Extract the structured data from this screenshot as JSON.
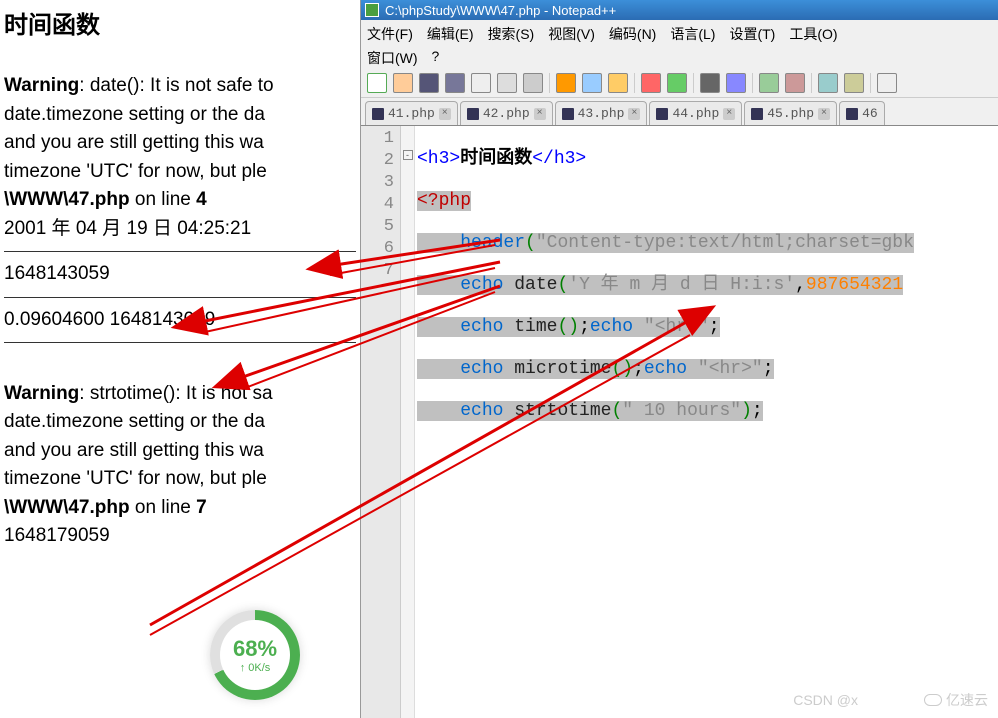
{
  "browser": {
    "heading": "时间函数",
    "warning1": {
      "label": "Warning",
      "msg1": ": date(): It is not safe to",
      "msg2": "date.timezone setting or the da",
      "msg3": "and you are still getting this wa",
      "msg4": "timezone 'UTC' for now, but ple",
      "path": "\\WWW\\47.php",
      "online": " on line ",
      "line": "4"
    },
    "date_output": "2001 年 04 月 19 日 04:25:21",
    "time_output": "1648143059",
    "microtime_output": "0.09604600 1648143059",
    "warning2": {
      "label": "Warning",
      "msg1": ": strtotime(): It is not sa",
      "msg2": "date.timezone setting or the da",
      "msg3": "and you are still getting this wa",
      "msg4": "timezone 'UTC' for now, but ple",
      "path": "\\WWW\\47.php",
      "online": " on line ",
      "line": "7"
    },
    "strtotime_output": "1648179059"
  },
  "npp": {
    "title": "C:\\phpStudy\\WWW\\47.php - Notepad++",
    "menu": {
      "row1": [
        "文件(F)",
        "编辑(E)",
        "搜索(S)",
        "视图(V)",
        "编码(N)",
        "语言(L)",
        "设置(T)",
        "工具(O)"
      ],
      "row2": [
        "窗口(W)",
        "?"
      ]
    },
    "toolbar_icons": [
      "new",
      "open",
      "save",
      "saveall",
      "close",
      "closeall",
      "print",
      "|",
      "cut",
      "copy",
      "paste",
      "|",
      "undo",
      "redo",
      "|",
      "find",
      "replace",
      "|",
      "zoom1",
      "zoom2",
      "|",
      "sync",
      "sync2",
      "|",
      "wrap"
    ],
    "tabs": [
      "41.php",
      "42.php",
      "43.php",
      "44.php",
      "45.php",
      "46"
    ],
    "code": {
      "line_numbers": [
        "1",
        "2",
        "3",
        "4",
        "5",
        "6",
        "7"
      ],
      "l1": {
        "tag_open": "<h3>",
        "text": "时间函数",
        "tag_close": "</h3>"
      },
      "l2": {
        "php_open": "<?php"
      },
      "l3": {
        "kw": "header",
        "paren1": "(",
        "str": "\"Content-type:text/html;charset=gbk",
        "paren2": ""
      },
      "l4": {
        "kw": "echo ",
        "func": "date",
        "paren1": "(",
        "str": "'Y 年 m 月 d 日 H:i:s'",
        "comma": ",",
        "num": "987654321",
        "paren2": ""
      },
      "l5": {
        "kw1": "echo ",
        "func1": "time",
        "p1": "()",
        "semi1": ";",
        "kw2": "echo ",
        "str2": "\"<hr>\"",
        "semi2": ";"
      },
      "l6": {
        "kw1": "echo ",
        "func1": "microtime",
        "p1": "()",
        "semi1": ";",
        "kw2": "echo ",
        "str2": "\"<hr>\"",
        "semi2": ";"
      },
      "l7": {
        "kw1": "echo ",
        "func1": "strtotime",
        "p1": "(",
        "str": "\" 10 hours\"",
        "p2": ")",
        "semi": ";"
      }
    }
  },
  "gauge": {
    "pct": "68%",
    "sub": "↑ 0K/s"
  },
  "watermark1": "CSDN @x",
  "watermark2": "亿速云"
}
